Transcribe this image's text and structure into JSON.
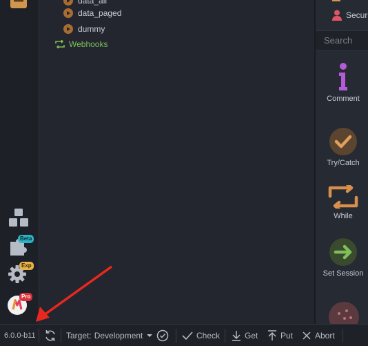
{
  "tree": {
    "items": [
      {
        "label": "data_all"
      },
      {
        "label": "data_paged"
      },
      {
        "label": "dummy"
      }
    ],
    "webhooks_label": "Webhooks"
  },
  "right_panel": {
    "top_label": "Secur",
    "search_placeholder": "Search",
    "items": [
      {
        "label": "Comment",
        "icon": "info-icon"
      },
      {
        "label": "Try/Catch",
        "icon": "checkmark-icon"
      },
      {
        "label": "While",
        "icon": "loop-icon"
      },
      {
        "label": "Set Session",
        "icon": "arrow-right-icon"
      }
    ]
  },
  "left_rail": {
    "beta_badge": "Beta",
    "exp_badge": "Exp",
    "pro_badge": "Pro",
    "version": "6.0.0-b11"
  },
  "status_bar": {
    "target_label": "Target:",
    "target_value": "Development",
    "check_label": "Check",
    "get_label": "Get",
    "put_label": "Put",
    "abort_label": "Abort"
  },
  "colors": {
    "accent_green": "#7fbf5a",
    "accent_orange": "#d98f4c",
    "purple": "#b45bd9",
    "red_arrow": "#e8281e"
  }
}
